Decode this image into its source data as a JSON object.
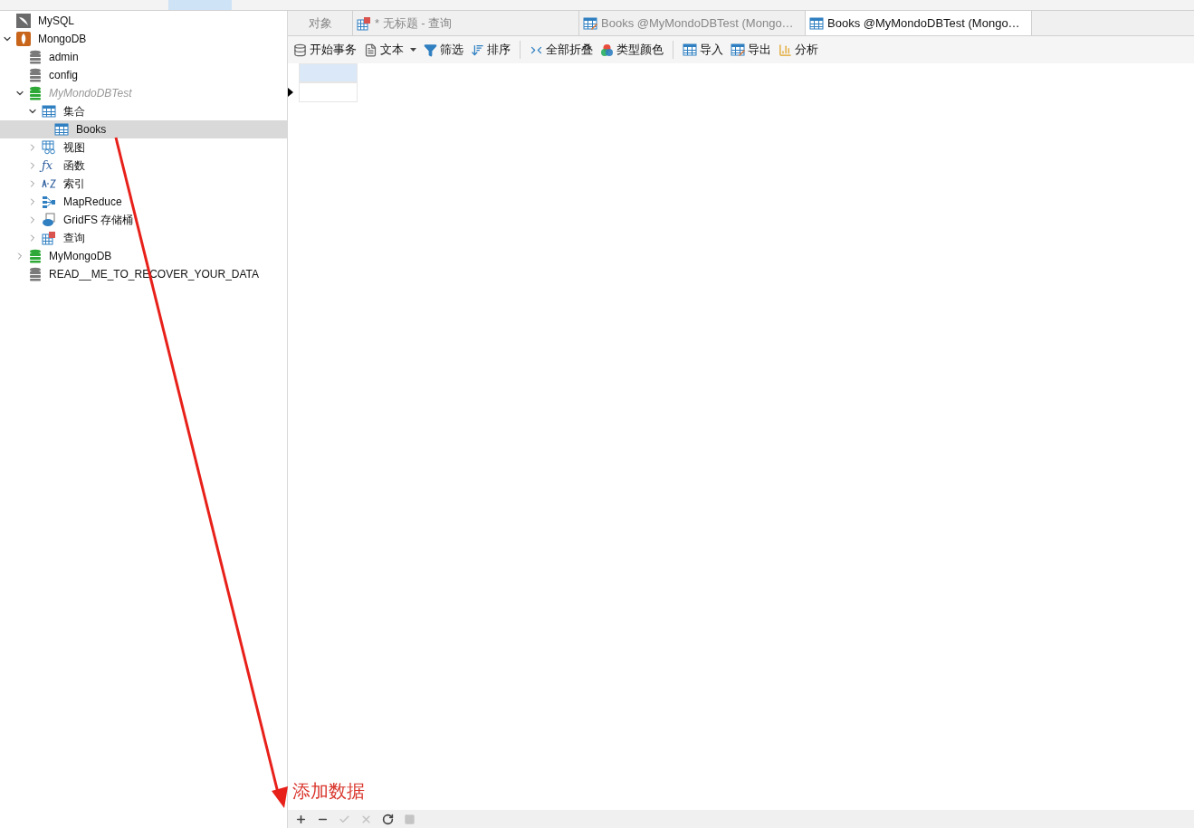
{
  "tree": [
    {
      "label": "MySQL",
      "kind": "mysql",
      "selected": false,
      "dimmed": false
    },
    {
      "label": "MongoDB",
      "kind": "mongodb",
      "expanded": true,
      "selected": false,
      "dimmed": false,
      "children": [
        {
          "label": "admin",
          "kind": "database",
          "selected": false,
          "dimmed": false
        },
        {
          "label": "config",
          "kind": "database",
          "selected": false,
          "dimmed": false
        },
        {
          "label": "MyMondoDBTest",
          "kind": "database-open",
          "expanded": true,
          "selected": false,
          "dimmed": true,
          "children": [
            {
              "label": "集合",
              "kind": "table",
              "expanded": true,
              "selected": false,
              "dimmed": false,
              "children": [
                {
                  "label": "Books",
                  "kind": "table",
                  "selected": true,
                  "dimmed": false
                }
              ]
            },
            {
              "label": "视图",
              "kind": "view",
              "expanded": false,
              "selected": false,
              "dimmed": false
            },
            {
              "label": "函数",
              "kind": "function",
              "glyph": "ƒx",
              "expanded": false,
              "selected": false,
              "dimmed": false
            },
            {
              "label": "索引",
              "kind": "index",
              "expanded": false,
              "selected": false,
              "dimmed": false
            },
            {
              "label": "MapReduce",
              "kind": "mapreduce",
              "expanded": false,
              "selected": false,
              "dimmed": false
            },
            {
              "label": "GridFS 存储桶",
              "kind": "gridfs",
              "expanded": false,
              "selected": false,
              "dimmed": false
            },
            {
              "label": "查询",
              "kind": "query",
              "expanded": false,
              "selected": false,
              "dimmed": false
            }
          ]
        },
        {
          "label": "MyMongoDB",
          "kind": "database-open",
          "expanded": false,
          "selected": false,
          "dimmed": false
        },
        {
          "label": "READ__ME_TO_RECOVER_YOUR_DATA",
          "kind": "database",
          "selected": false,
          "dimmed": false
        }
      ]
    }
  ],
  "tabs": [
    {
      "label": "对象",
      "kind": "objects",
      "selected": false
    },
    {
      "label": "* 无标题 - 查询",
      "kind": "query",
      "selected": false
    },
    {
      "label": "Books @MyMondoDBTest (Mongo…",
      "kind": "table-edit",
      "selected": false
    },
    {
      "label": "Books @MyMondoDBTest (Mongo…",
      "kind": "table",
      "selected": true
    }
  ],
  "toolbar": [
    [
      {
        "label": "开始事务",
        "kind": "transaction",
        "dropdown": false
      },
      {
        "label": "文本",
        "kind": "text",
        "dropdown": true
      },
      {
        "label": "筛选",
        "kind": "filter",
        "dropdown": false
      },
      {
        "label": "排序",
        "kind": "sort",
        "dropdown": false
      }
    ],
    [
      {
        "label": "全部折叠",
        "kind": "collapse",
        "dropdown": false
      },
      {
        "label": "类型颜色",
        "kind": "color",
        "dropdown": false
      }
    ],
    [
      {
        "label": "导入",
        "kind": "import",
        "dropdown": false
      },
      {
        "label": "导出",
        "kind": "export",
        "dropdown": false
      },
      {
        "label": "分析",
        "kind": "chart",
        "dropdown": false
      }
    ]
  ],
  "bottom_bar": [
    {
      "kind": "add",
      "disabled": false
    },
    {
      "kind": "remove",
      "disabled": false
    },
    {
      "kind": "apply",
      "disabled": true
    },
    {
      "kind": "discard",
      "disabled": true
    },
    {
      "kind": "refresh",
      "disabled": false
    },
    {
      "kind": "stop",
      "disabled": true
    }
  ],
  "annotation": {
    "text": "添加数据"
  }
}
